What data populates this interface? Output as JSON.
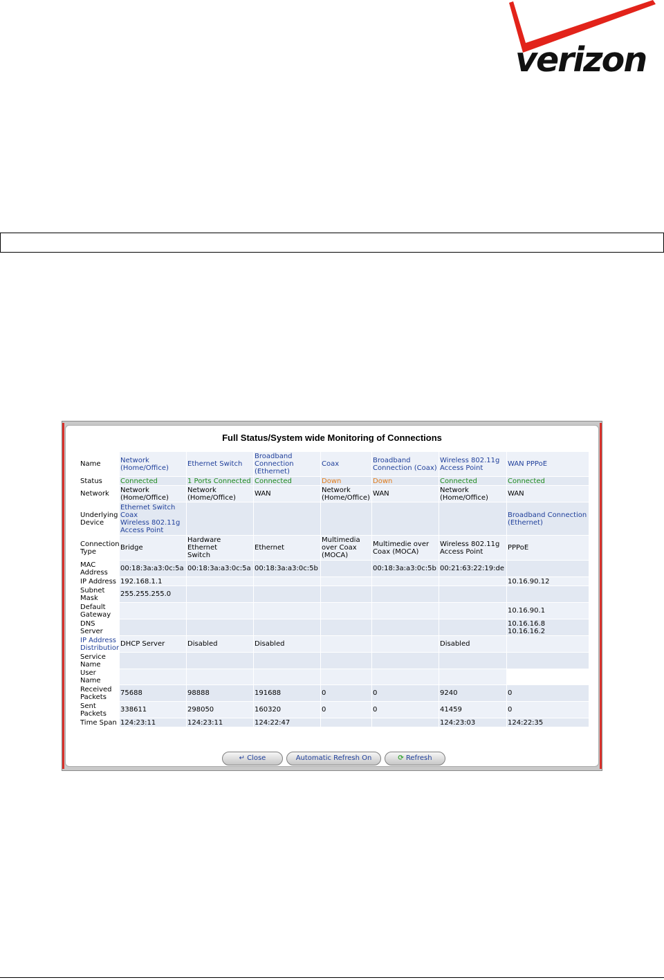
{
  "logo": {
    "text": "verizon",
    "red": "#e2231a"
  },
  "panel": {
    "title": "Full Status/System wide Monitoring of Connections"
  },
  "table": {
    "header": {
      "label": "Name",
      "cells": [
        "Network\n(Home/Office)",
        "Ethernet Switch",
        "Broadband\nConnection\n(Ethernet)",
        "Coax",
        "Broadband\nConnection (Coax)",
        "Wireless 802.11g\nAccess Point",
        "WAN PPPoE"
      ]
    },
    "rows": [
      {
        "label": "Status",
        "cells": [
          "Connected",
          "1 Ports Connected",
          "Connected",
          "Down",
          "Down",
          "Connected",
          "Connected"
        ]
      },
      {
        "label": "Network",
        "cells": [
          "Network\n(Home/Office)",
          "Network\n(Home/Office)",
          "WAN",
          "Network\n(Home/Office)",
          "WAN",
          "Network\n(Home/Office)",
          "WAN"
        ]
      },
      {
        "label": "Underlying\nDevice",
        "cells": [
          "Ethernet Switch\nCoax\nWireless 802.11g\nAccess Point",
          "",
          "",
          "",
          "",
          "",
          "Broadband Connection\n(Ethernet)"
        ]
      },
      {
        "label": "Connection\nType",
        "cells": [
          "Bridge",
          "Hardware Ethernet\nSwitch",
          "Ethernet",
          "Multimedia\nover Coax\n(MOCA)",
          "Multimedie over\nCoax (MOCA)",
          "Wireless 802.11g\nAccess Point",
          "PPPoE"
        ]
      },
      {
        "label": "MAC\nAddress",
        "cells": [
          "00:18:3a:a3:0c:5a",
          "00:18:3a:a3:0c:5a",
          "00:18:3a:a3:0c:5b",
          "",
          "00:18:3a:a3:0c:5b",
          "00:21:63:22:19:de",
          ""
        ]
      },
      {
        "label": "IP Address",
        "cells": [
          "192.168.1.1",
          "",
          "",
          "",
          "",
          "",
          "10.16.90.12"
        ]
      },
      {
        "label": "Subnet\nMask",
        "cells": [
          "255.255.255.0",
          "",
          "",
          "",
          "",
          "",
          ""
        ]
      },
      {
        "label": "Default\nGateway",
        "cells": [
          "",
          "",
          "",
          "",
          "",
          "",
          "10.16.90.1"
        ]
      },
      {
        "label": "DNS\nServer",
        "cells": [
          "",
          "",
          "",
          "",
          "",
          "",
          "10.16.16.8\n10.16.16.2"
        ]
      },
      {
        "label": "IP Address\nDistribution",
        "cells": [
          "DHCP Server",
          "Disabled",
          "Disabled",
          "",
          "",
          "Disabled",
          ""
        ]
      },
      {
        "label": "Service\nName",
        "cells": [
          "",
          "",
          "",
          "",
          "",
          "",
          ""
        ]
      },
      {
        "label": "User Name",
        "cells": [
          "",
          "",
          "",
          "",
          "",
          "",
          ""
        ]
      },
      {
        "label": "Received\nPackets",
        "cells": [
          "75688",
          "98888",
          "191688",
          "0",
          "0",
          "9240",
          "0"
        ]
      },
      {
        "label": "Sent\nPackets",
        "cells": [
          "338611",
          "298050",
          "160320",
          "0",
          "0",
          "41459",
          "0"
        ]
      },
      {
        "label": "Time Span",
        "cells": [
          "124:23:11",
          "124:23:11",
          "124:22:47",
          "",
          "",
          "124:23:03",
          "124:22:35"
        ]
      }
    ]
  },
  "buttons": {
    "close": "Close",
    "auto_refresh": "Automatic Refresh On",
    "refresh": "Refresh"
  }
}
